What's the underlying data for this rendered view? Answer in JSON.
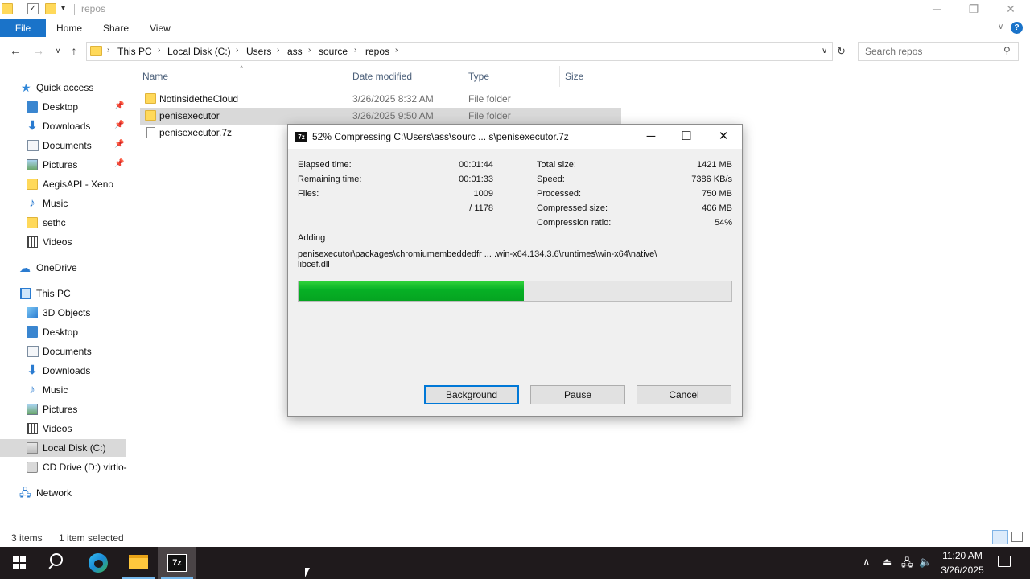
{
  "explorer": {
    "title": "repos",
    "ribbon_tabs": [
      "File",
      "Home",
      "Share",
      "View"
    ],
    "breadcrumbs": [
      "This PC",
      "Local Disk (C:)",
      "Users",
      "ass",
      "source",
      "repos"
    ],
    "search_placeholder": "Search repos",
    "columns": [
      "Name",
      "Date modified",
      "Type",
      "Size"
    ],
    "files": [
      {
        "name": "NotinsidetheCloud",
        "date": "3/26/2025 8:32 AM",
        "type": "File folder",
        "kind": "folder"
      },
      {
        "name": "penisexecutor",
        "date": "3/26/2025 9:50 AM",
        "type": "File folder",
        "kind": "folder",
        "selected": true
      },
      {
        "name": "penisexecutor.7z",
        "date": "",
        "type": "",
        "kind": "file"
      }
    ],
    "nav": {
      "quick_access": "Quick access",
      "quick_items": [
        "Desktop",
        "Downloads",
        "Documents",
        "Pictures",
        "AegisAPI - Xeno",
        "Music",
        "sethc",
        "Videos"
      ],
      "onedrive": "OneDrive",
      "this_pc": "This PC",
      "pc_items": [
        "3D Objects",
        "Desktop",
        "Documents",
        "Downloads",
        "Music",
        "Pictures",
        "Videos",
        "Local Disk (C:)",
        "CD Drive (D:) virtio-"
      ],
      "network": "Network"
    },
    "status": {
      "items": "3 items",
      "selected": "1 item selected"
    }
  },
  "dialog": {
    "title": "52% Compressing C:\\Users\\ass\\sourc ... s\\penisexecutor.7z",
    "elapsed_label": "Elapsed time:",
    "elapsed_value": "00:01:44",
    "remaining_label": "Remaining time:",
    "remaining_value": "00:01:33",
    "files_label": "Files:",
    "files_value": "1009",
    "files_total": "/ 1178",
    "total_size_label": "Total size:",
    "total_size_value": "1421 MB",
    "speed_label": "Speed:",
    "speed_value": "7386 KB/s",
    "processed_label": "Processed:",
    "processed_value": "750 MB",
    "compressed_label": "Compressed size:",
    "compressed_value": "406 MB",
    "ratio_label": "Compression ratio:",
    "ratio_value": "54%",
    "adding_label": "Adding",
    "adding_path_line1": "penisexecutor\\packages\\chromiumembeddedfr ... .win-x64.134.3.6\\runtimes\\win-x64\\native\\",
    "adding_path_line2": "libcef.dll",
    "progress": 0.52,
    "buttons": {
      "background": "Background",
      "pause": "Pause",
      "cancel": "Cancel"
    }
  },
  "taskbar": {
    "time": "11:20 AM",
    "date": "3/26/2025"
  },
  "colors": {
    "accent": "#1a73c9",
    "progress_green": "#06b025",
    "taskbar": "#1f1a1c"
  }
}
